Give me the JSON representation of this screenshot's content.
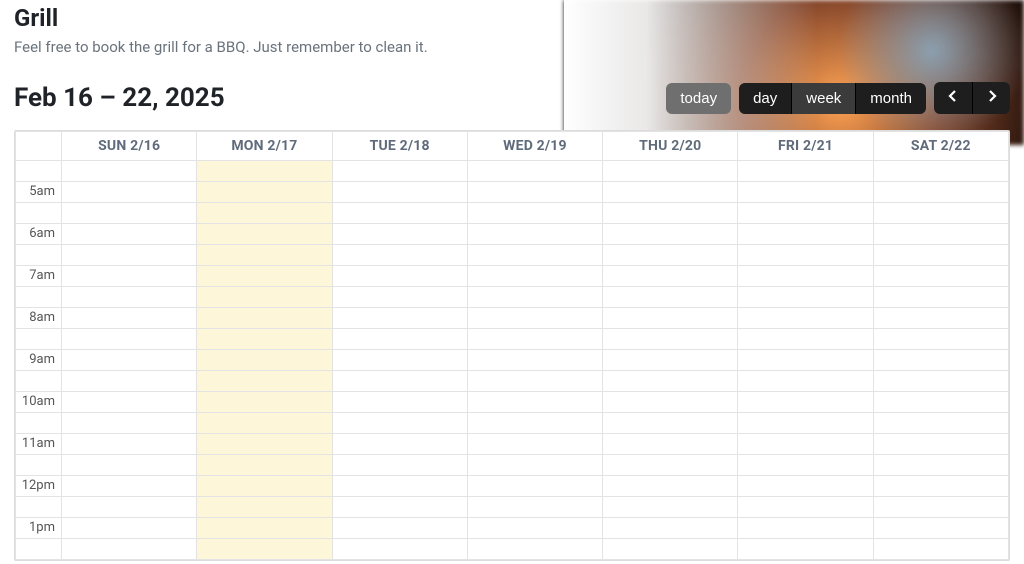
{
  "header": {
    "title": "Grill",
    "subtitle": "Feel free to book the grill for a BBQ. Just remember to clean it."
  },
  "range_label": "Feb 16 – 22, 2025",
  "controls": {
    "today": "today",
    "views": {
      "day": "day",
      "week": "week",
      "month": "month"
    },
    "active_view": "week"
  },
  "days": [
    {
      "label": "SUN 2/16",
      "is_today": false
    },
    {
      "label": "MON 2/17",
      "is_today": true
    },
    {
      "label": "TUE 2/18",
      "is_today": false
    },
    {
      "label": "WED 2/19",
      "is_today": false
    },
    {
      "label": "THU 2/20",
      "is_today": false
    },
    {
      "label": "FRI 2/21",
      "is_today": false
    },
    {
      "label": "SAT 2/22",
      "is_today": false
    }
  ],
  "hours": [
    "5am",
    "6am",
    "7am",
    "8am",
    "9am",
    "10am",
    "11am",
    "12pm",
    "1pm"
  ]
}
